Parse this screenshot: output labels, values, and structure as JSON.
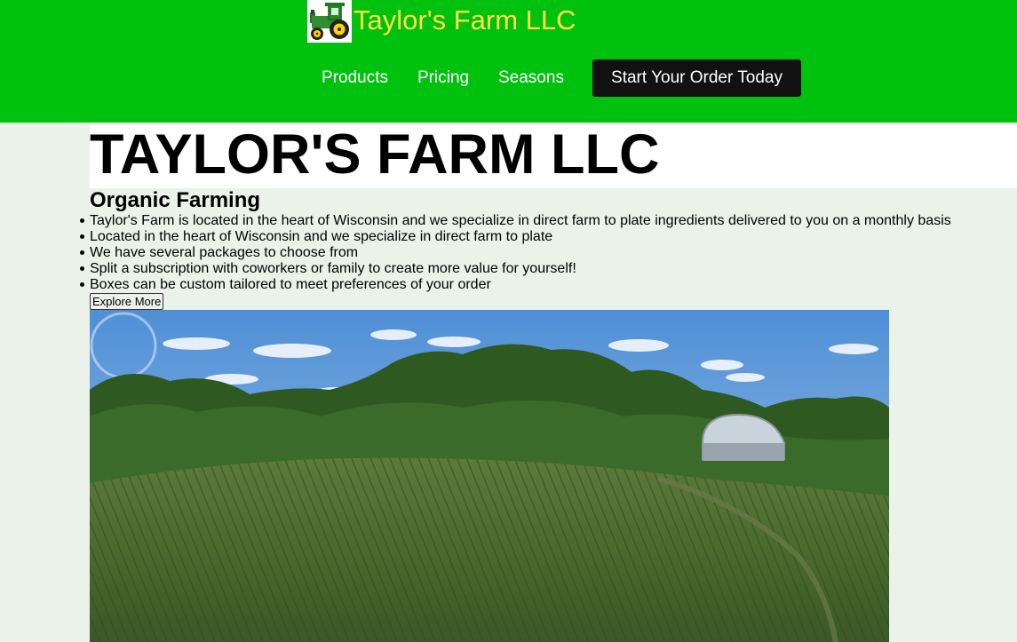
{
  "header": {
    "brand": "Taylor's Farm LLC",
    "logo_icon": "tractor-icon",
    "nav": [
      "Products",
      "Pricing",
      "Seasons"
    ],
    "cta_label": "Start Your Order Today",
    "colors": {
      "bar": "#00c20e",
      "brand_text": "#ffe14a",
      "cta_bg": "#111111"
    }
  },
  "hero": {
    "title": "TAYLOR'S FARM LLC",
    "subtitle": "Organic Farming",
    "features": [
      "Taylor's Farm is located in the heart of Wisconsin and we specialize in direct farm to plate ingredients delivered to you on a monthly basis",
      "Located in the heart of Wisconsin and we specialize in direct farm to plate",
      "We have several packages to choose from",
      "Split a subscription with coworkers or family to create more value for yourself!",
      "Boxes can be custom tailored to meet preferences of your order"
    ],
    "explore_label": "Explore More"
  },
  "photo": {
    "subject": "aerial-cornfield-with-barn"
  },
  "page": {
    "background": "#eaf2ea"
  }
}
